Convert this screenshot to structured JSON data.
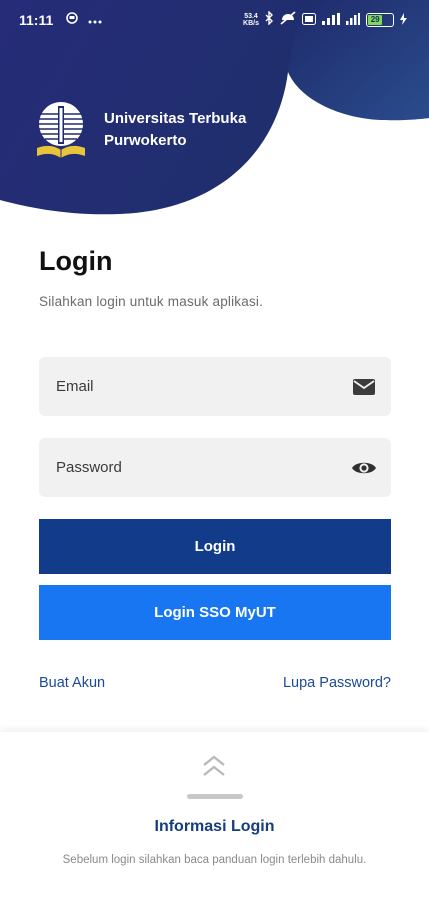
{
  "status_bar": {
    "time": "11:11",
    "network_speed_top": "53.4",
    "network_speed_bottom": "KB/s",
    "battery_level": "29"
  },
  "brand": {
    "line1": "Universitas Terbuka",
    "line2": "Purwokerto"
  },
  "login": {
    "title": "Login",
    "subtitle": "Silahkan login untuk masuk aplikasi.",
    "email_placeholder": "Email",
    "password_placeholder": "Password",
    "login_button": "Login",
    "sso_button": "Login SSO MyUT",
    "register_link": "Buat Akun",
    "forgot_link": "Lupa Password?"
  },
  "info_sheet": {
    "title": "Informasi Login",
    "description": "Sebelum login silahkan baca panduan login terlebih dahulu."
  },
  "colors": {
    "header_dark": "#1f2a6b",
    "login_button": "#123c8a",
    "sso_button": "#1876f2",
    "link": "#1c4a96"
  },
  "icons": {
    "email_field": "mail-icon",
    "password_field": "eye-icon",
    "sheet": "double-chevron-up-icon"
  }
}
